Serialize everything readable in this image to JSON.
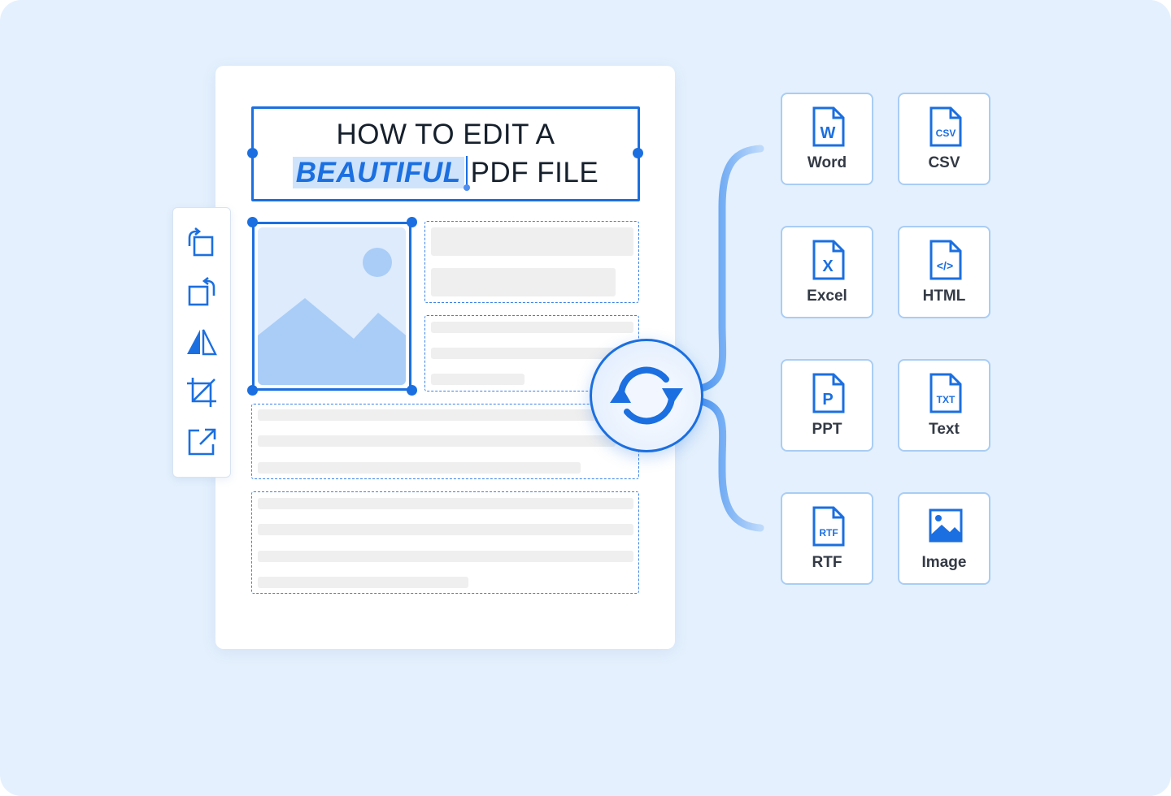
{
  "document": {
    "title_line1": "HOW TO EDIT A",
    "title_highlight": "BEAUTIFUL",
    "title_rest": "PDF FILE"
  },
  "toolbar": {
    "tools": [
      {
        "icon": "rotate-left-icon"
      },
      {
        "icon": "rotate-right-icon"
      },
      {
        "icon": "flip-icon"
      },
      {
        "icon": "crop-icon"
      },
      {
        "icon": "extract-icon"
      }
    ]
  },
  "convert": {
    "icon": "sync-icon"
  },
  "formats": [
    {
      "label": "Word",
      "icon": "word-file-icon",
      "glyph": "W"
    },
    {
      "label": "CSV",
      "icon": "csv-file-icon",
      "glyph": "CSV"
    },
    {
      "label": "Excel",
      "icon": "excel-file-icon",
      "glyph": "X"
    },
    {
      "label": "HTML",
      "icon": "html-file-icon",
      "glyph": "</>"
    },
    {
      "label": "PPT",
      "icon": "ppt-file-icon",
      "glyph": "P"
    },
    {
      "label": "Text",
      "icon": "txt-file-icon",
      "glyph": "TXT"
    },
    {
      "label": "RTF",
      "icon": "rtf-file-icon",
      "glyph": "RTF"
    },
    {
      "label": "Image",
      "icon": "image-file-icon",
      "glyph": ""
    }
  ],
  "colors": {
    "accent": "#1b6fe0",
    "background": "#e4f0fd",
    "card_border": "#a9cdf5",
    "placeholder_bar": "#efefef"
  }
}
